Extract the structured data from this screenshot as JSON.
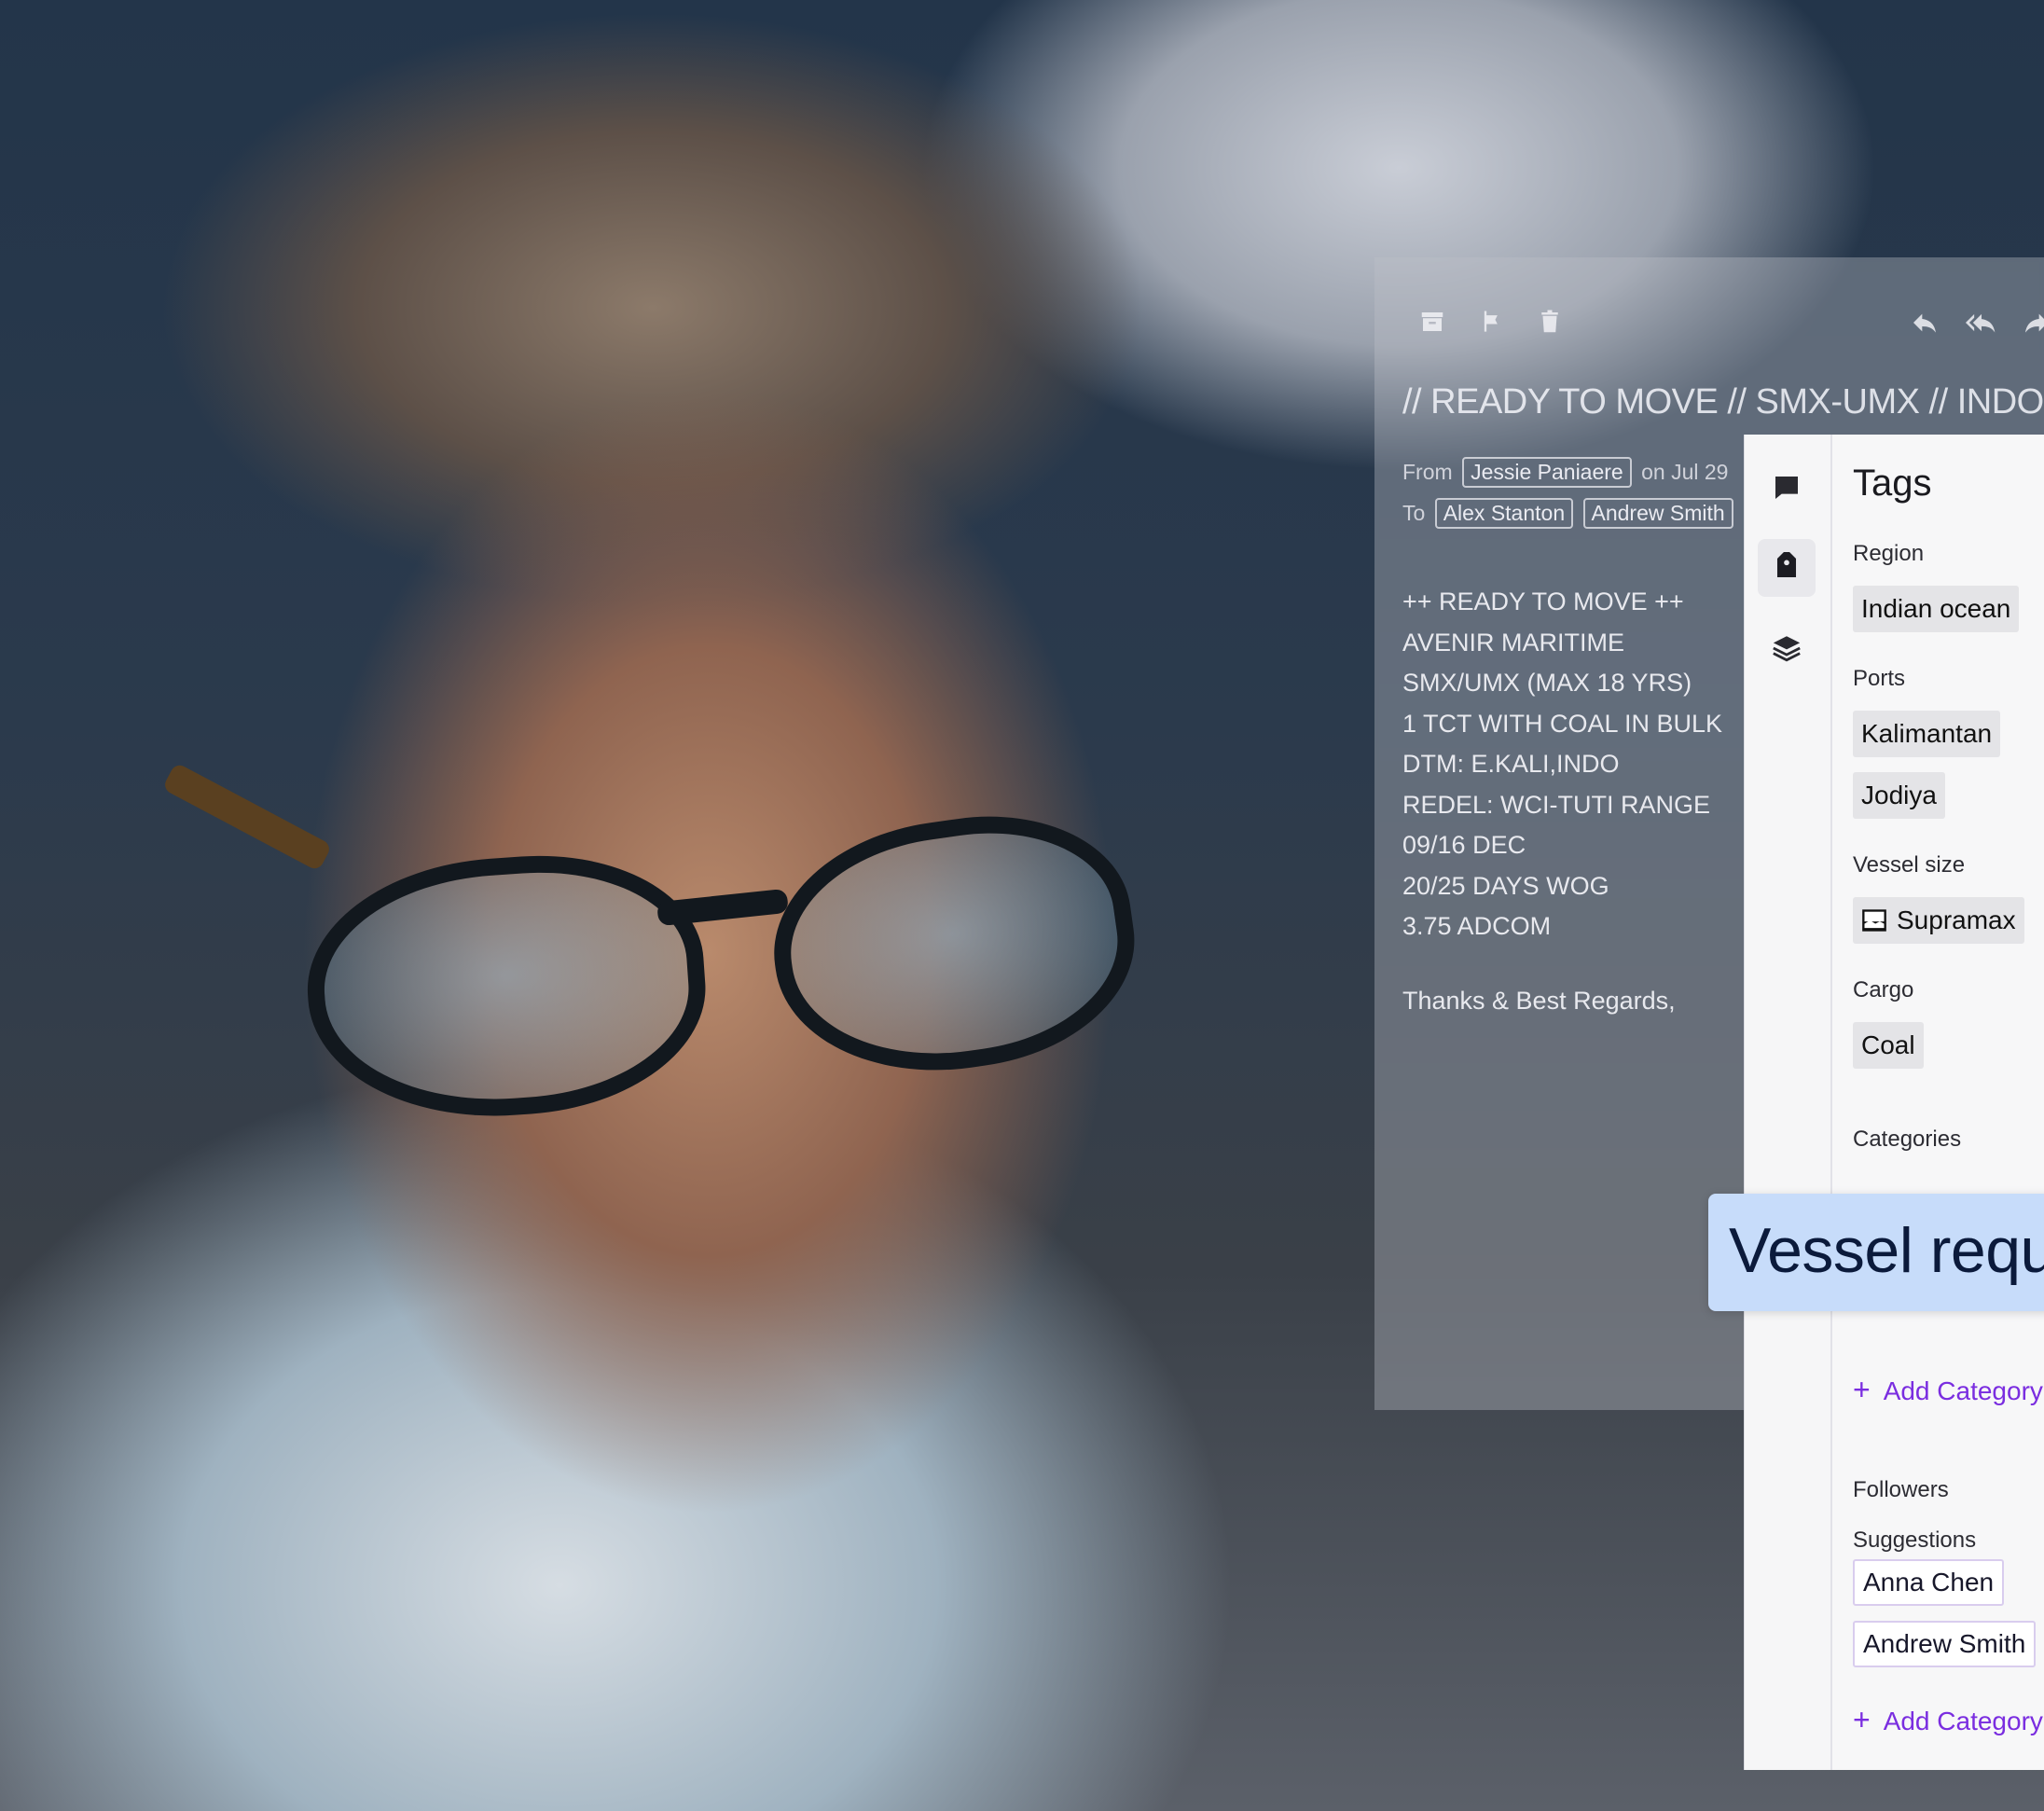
{
  "email": {
    "toolbar": {
      "left_icons": [
        "archive-icon",
        "flag-icon",
        "delete-icon"
      ],
      "right_icons": [
        "reply-icon",
        "reply-all-icon",
        "forward-icon"
      ]
    },
    "subject": "// READY TO MOVE // SMX-UMX // INDO",
    "from_label": "From",
    "from_name": "Jessie Paniaere",
    "date_text": "on Jul 29",
    "to_label": "To",
    "to_names": [
      "Alex Stanton",
      "Andrew Smith"
    ],
    "body_lines": [
      "++ READY TO MOVE ++",
      "AVENIR MARITIME",
      "SMX/UMX (MAX 18 YRS)",
      "1 TCT WITH COAL IN BULK",
      "DTM: E.KALI,INDO",
      "REDEL: WCI-TUTI RANGE",
      "09/16 DEC",
      "20/25 DAYS WOG",
      "3.75 ADCOM"
    ],
    "signoff": "Thanks & Best Regards,"
  },
  "side_panel": {
    "rail_icons": [
      "comment-icon",
      "tag-icon",
      "layers-icon"
    ],
    "title": "Tags",
    "region": {
      "label": "Region",
      "tags": [
        "Indian ocean"
      ]
    },
    "ports": {
      "label": "Ports",
      "tags": [
        "Kalimantan",
        "Jodiya"
      ]
    },
    "vessel_size": {
      "label": "Vessel size",
      "tags": [
        "Supramax"
      ]
    },
    "cargo": {
      "label": "Cargo",
      "tags": [
        "Coal"
      ]
    },
    "categories": {
      "label": "Categories",
      "add_label": "Add Category"
    },
    "followers": {
      "label": "Followers",
      "suggestions_label": "Suggestions",
      "suggestions": [
        "Anna Chen",
        "Andrew Smith"
      ],
      "add_label": "Add Category"
    }
  },
  "banner": {
    "text": "Vessel requ"
  },
  "colors": {
    "accent": "#7a2de0",
    "banner_bg": "#c7dcfa",
    "banner_text": "#0b1a3b"
  }
}
